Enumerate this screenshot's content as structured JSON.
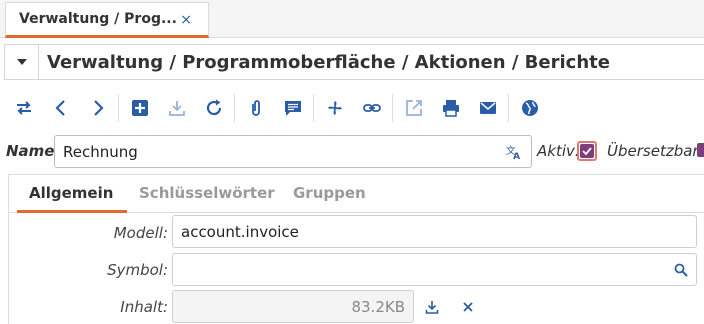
{
  "tab": {
    "label": "Verwaltung / Prog...",
    "close": "×"
  },
  "title": "Verwaltung / Programmoberfläche / Aktionen / Berichte",
  "toolbar": {
    "icons": [
      "switch-view-icon",
      "previous-icon",
      "next-icon",
      "new-record-icon",
      "save-icon",
      "reload-icon",
      "attachment-icon",
      "notes-icon",
      "action-icon",
      "relate-icon",
      "open-external-icon",
      "print-icon",
      "email-icon",
      "globe-icon"
    ]
  },
  "name": {
    "label": "Name:",
    "value": "Rechnung"
  },
  "aktiv": {
    "label": "Aktiv:",
    "checked": true
  },
  "uebersetzbar": {
    "label": "Übersetzbar:",
    "checked": true
  },
  "notebook": {
    "tabs": [
      "Allgemein",
      "Schlüsselwörter",
      "Gruppen"
    ],
    "active": "Allgemein"
  },
  "fields": {
    "modell": {
      "label": "Modell:",
      "value": "account.invoice"
    },
    "symbol": {
      "label": "Symbol:",
      "value": ""
    },
    "inhalt": {
      "label": "Inhalt:",
      "value": "83.2KB"
    }
  },
  "colors": {
    "accent": "#e26a2c",
    "icon_blue": "#2a5da8",
    "checkbox_purple": "#7c3f7c"
  }
}
